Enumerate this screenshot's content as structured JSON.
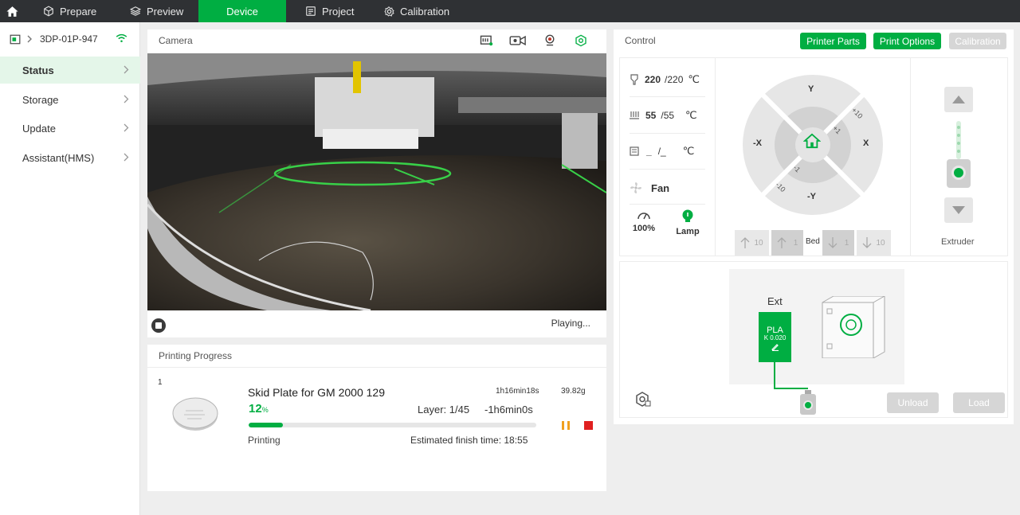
{
  "colors": {
    "accent": "#00ae42",
    "topbar": "#2f3134",
    "stop": "#e02020",
    "pause": "#f0a020"
  },
  "topbar": {
    "home_icon": "home-icon",
    "tabs": [
      {
        "label": "Prepare",
        "icon": "cube-icon"
      },
      {
        "label": "Preview",
        "icon": "layers-icon"
      },
      {
        "label": "Device",
        "icon": "",
        "active": true
      },
      {
        "label": "Project",
        "icon": "document-icon"
      },
      {
        "label": "Calibration",
        "icon": "gear-icon"
      }
    ]
  },
  "sidebar": {
    "device_name": "3DP-01P-947",
    "items": [
      {
        "label": "Status",
        "active": true
      },
      {
        "label": "Storage"
      },
      {
        "label": "Update"
      },
      {
        "label": "Assistant(HMS)"
      }
    ]
  },
  "camera": {
    "title": "Camera",
    "status": "Playing..."
  },
  "progress": {
    "title": "Printing Progress",
    "plate_index": "1",
    "job_name": "Skid Plate for GM 2000 129",
    "duration": "1h16min18s",
    "weight": "39.82g",
    "percent": "12",
    "percent_unit": "%",
    "percent_value": 0.12,
    "layer": "Layer: 1/45",
    "remaining": "-1h6min0s",
    "state": "Printing",
    "finish": "Estimated finish time: 18:55"
  },
  "control": {
    "title": "Control",
    "printer_parts": "Printer Parts",
    "print_options": "Print Options",
    "calibration": "Calibration",
    "nozzle_temp": "220",
    "nozzle_target": "/220",
    "bed_temp": "55",
    "bed_target": "/55",
    "chamber_temp": "_",
    "chamber_target": "/_",
    "unit": "℃",
    "fan": "Fan",
    "speed": "100%",
    "lamp": "Lamp",
    "jog": {
      "y": "Y",
      "neg_y": "-Y",
      "x": "X",
      "neg_x": "-X",
      "p10": "+10",
      "p1": "+1",
      "m1": "-1",
      "m10": "-10"
    },
    "bed": {
      "label": "Bed",
      "up10": "10",
      "up1": "1",
      "down1": "1",
      "down10": "10"
    },
    "extruder": "Extruder"
  },
  "ams": {
    "ext_label": "Ext",
    "material": "PLA",
    "k_value": "K 0.020",
    "unload": "Unload",
    "load": "Load"
  }
}
